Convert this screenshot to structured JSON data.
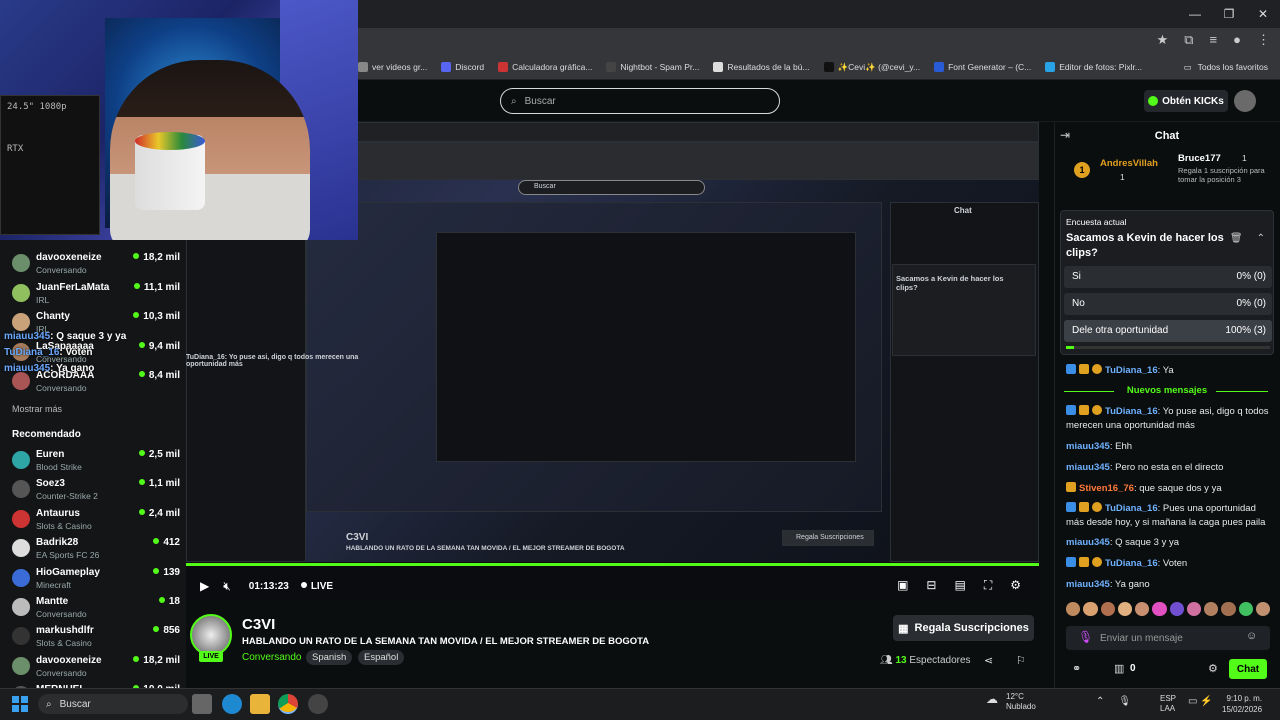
{
  "browser": {
    "bookmarks": [
      {
        "label": "ver videos gr...",
        "color": "#888"
      },
      {
        "label": "Discord",
        "color": "#5865f2"
      },
      {
        "label": "Calculadora gráfica...",
        "color": "#c33"
      },
      {
        "label": "Nightbot - Spam Pr...",
        "color": "#444"
      },
      {
        "label": "Resultados de la bú...",
        "color": "#ddd"
      },
      {
        "label": "✨Cevi✨ (@cevi_y...",
        "color": "#111"
      },
      {
        "label": "Font Generator – (C...",
        "color": "#2a5bd7"
      },
      {
        "label": "Editor de fotos: Pixlr...",
        "color": "#28a3e6"
      }
    ],
    "all_bookmarks": "Todos los favoritos"
  },
  "kick": {
    "search_placeholder": "Buscar",
    "get_kicks": "Obtén KICKs"
  },
  "webcam": {
    "pc_text": "24.5\" 1080p",
    "pc_brand": "RTX"
  },
  "sidebar": {
    "following": [
      {
        "name": "davooxeneize",
        "category": "Conversando",
        "viewers": "18,2 mil",
        "color": "#6b8e6b"
      },
      {
        "name": "JuanFerLaMata",
        "category": "IRL",
        "viewers": "11,1 mil",
        "color": "#8fbf5f"
      },
      {
        "name": "Chanty",
        "category": "IRL",
        "viewers": "10,3 mil",
        "color": "#c9a27a"
      },
      {
        "name": "LaSapaaaaa",
        "category": "Conversando",
        "viewers": "9,4 mil",
        "color": "#a87c5a"
      },
      {
        "name": "ACORDAAA",
        "category": "Conversando",
        "viewers": "8,4 mil",
        "color": "#a55"
      }
    ],
    "show_more": "Mostrar más",
    "recommended_title": "Recomendado",
    "recommended": [
      {
        "name": "Euren",
        "category": "Blood Strike",
        "viewers": "2,5 mil",
        "color": "#2fa6a6"
      },
      {
        "name": "Soez3",
        "category": "Counter-Strike 2",
        "viewers": "1,1 mil",
        "color": "#555"
      },
      {
        "name": "Antaurus",
        "category": "Slots & Casino",
        "viewers": "2,4 mil",
        "color": "#c33"
      },
      {
        "name": "Badrik28",
        "category": "EA Sports FC 26",
        "viewers": "412",
        "color": "#ddd"
      },
      {
        "name": "HioGameplay",
        "category": "Minecraft",
        "viewers": "139",
        "color": "#3a6bd6"
      },
      {
        "name": "Mantte",
        "category": "Conversando",
        "viewers": "18",
        "color": "#bbb"
      },
      {
        "name": "markushdlfr",
        "category": "Slots & Casino",
        "viewers": "856",
        "color": "#333"
      },
      {
        "name": "davooxeneize",
        "category": "Conversando",
        "viewers": "18,2 mil",
        "color": "#6b8e6b"
      },
      {
        "name": "MERNUEL",
        "category": "",
        "viewers": "10,0 mil",
        "color": "#555"
      }
    ],
    "overlay_chat": [
      {
        "user": "miauu345",
        "text": ": Q saque 3 y ya"
      },
      {
        "user": "TuDiana_16",
        "text": ": Voten"
      },
      {
        "user": "miauu345",
        "text": ": Ya gano"
      }
    ]
  },
  "video": {
    "time": "01:13:23",
    "live": "LIVE",
    "nested_search": "Buscar",
    "nested_streamer": "C3VI",
    "nested_title": "HABLANDO UN RATO DE LA SEMANA TAN MOVIDA / EL MEJOR STREAMER DE BOGOTA",
    "nested_subs": "Regala Suscripciones",
    "nested_chat": "Chat",
    "nested_poll_q": "Sacamos a Kevin de hacer los clips?",
    "nested_overlay": "TuDiana_16: Yo puse asi, digo q todos merecen una oportunidad más"
  },
  "stream": {
    "streamer": "C3VI",
    "live_badge": "LIVE",
    "title": "HABLANDO UN RATO DE LA SEMANA TAN MOVIDA / EL MEJOR STREAMER DE BOGOTA",
    "category": "Conversando",
    "tags": [
      "Spanish",
      "Español"
    ],
    "gift_subs": "Regala Suscripciones",
    "viewers_count": "13",
    "viewers_label": "Espectadores"
  },
  "chat": {
    "title": "Chat",
    "pinned_user1": "AndresVillah",
    "pinned_user1_count": "1",
    "pinned_user2": "Bruce177",
    "pinned_user2_count": "1",
    "pinned_text": "Regala 1 suscripción para tomar la posición 3",
    "poll": {
      "label": "Encuesta actual",
      "question": "Sacamos a Kevin de hacer los clips?",
      "options": [
        {
          "label": "Si",
          "result": "0% (0)",
          "fraction": 0
        },
        {
          "label": "No",
          "result": "0% (0)",
          "fraction": 0
        },
        {
          "label": "Dele otra oportunidad",
          "result": "100% (3)",
          "fraction": 1
        }
      ],
      "time_remaining_fraction": 0.04
    },
    "pre_msg": {
      "user": "TuDiana_16",
      "text": ": Ya"
    },
    "new_messages": "Nuevos mensajes",
    "messages": [
      {
        "user": "TuDiana_16",
        "text": ": Yo puse asi, digo q todos merecen una oportunidad más",
        "badges": true,
        "orange": false
      },
      {
        "user": "miauu345",
        "text": ": Ehh",
        "badges": false,
        "orange": false
      },
      {
        "user": "miauu345",
        "text": ": Pero no esta en el directo",
        "badges": false,
        "orange": false
      },
      {
        "user": "Stiven16_76",
        "text": ": que saque dos y ya",
        "badges": false,
        "orange": true
      },
      {
        "user": "TuDiana_16",
        "text": ": Pues una oportunidad más desde hoy, y si mañana la caga pues paila",
        "badges": true,
        "orange": false
      },
      {
        "user": "miauu345",
        "text": ": Q saque 3 y ya",
        "badges": false,
        "orange": false
      },
      {
        "user": "TuDiana_16",
        "text": ": Voten",
        "badges": true,
        "orange": false
      },
      {
        "user": "miauu345",
        "text": ": Ya gano",
        "badges": false,
        "orange": false
      }
    ],
    "input_placeholder": "Enviar un mensaje",
    "points": "0",
    "send": "Chat"
  },
  "taskbar": {
    "search": "Buscar",
    "temp": "12°C",
    "weather": "Nublado",
    "lang1": "ESP",
    "lang2": "LAA",
    "time": "9:10 p. m.",
    "date": "15/02/2026"
  }
}
